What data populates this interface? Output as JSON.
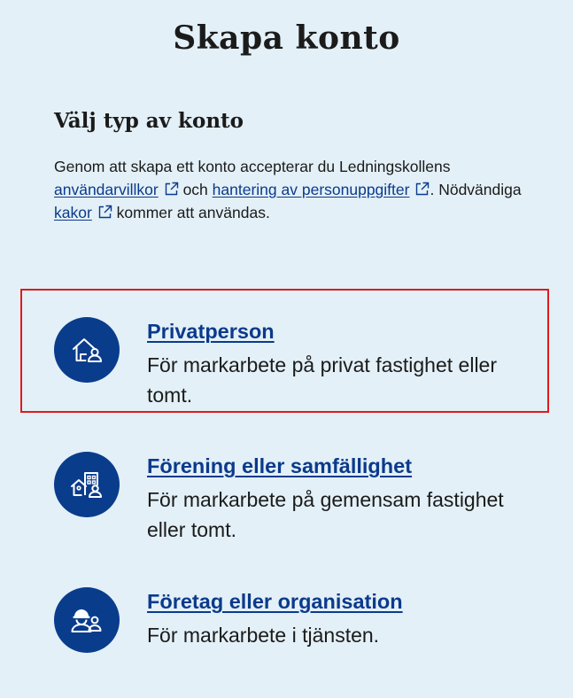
{
  "page": {
    "title": "Skapa konto"
  },
  "account_type": {
    "heading": "Välj typ av konto",
    "intro": {
      "text_1": "Genom att skapa ett konto accepterar du Ledningskollens",
      "link_terms": "användarvillkor",
      "text_2": "och",
      "link_privacy": "hantering av personuppgifter",
      "text_3": ". Nödvändiga",
      "link_cookies": "kakor",
      "text_4": "kommer att användas."
    },
    "options": [
      {
        "title": "Privatperson",
        "description": "För markarbete på privat fastighet eller tomt.",
        "icon": "house-person-icon",
        "highlighted": true
      },
      {
        "title": "Förening eller samfällighet",
        "description": "För markarbete på gemensam fastighet eller tomt.",
        "icon": "buildings-person-icon",
        "highlighted": false
      },
      {
        "title": "Företag eller organisation",
        "description": "För markarbete i tjänsten.",
        "icon": "workers-icon",
        "highlighted": false
      }
    ]
  },
  "colors": {
    "background": "#e3f0f7",
    "primary": "#0a3c8c",
    "link": "#0b3a8c",
    "highlight_border": "#e01a1a",
    "text": "#1b1b1b"
  }
}
